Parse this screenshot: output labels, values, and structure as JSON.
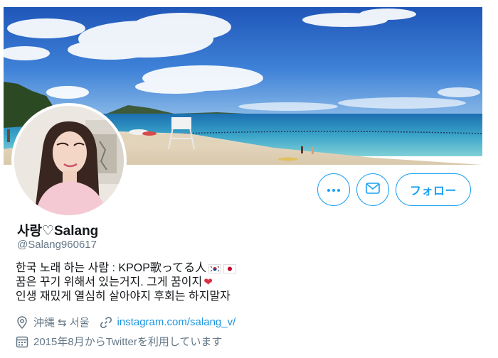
{
  "profile": {
    "display_name": "사랑♡Salang",
    "handle": "@Salang960617",
    "bio": {
      "line1": "한국 노래 하는 사람 : KPOP歌ってる人",
      "line2": "꿈은 꾸기 위해서 있는거지. 그게 꿈이지",
      "line3": "인생 재밌게 열심히 살아야지 후회는 하지말자"
    },
    "location": "沖縄 ⇆ 서울",
    "website": "instagram.com/salang_v/",
    "joined": "2015年8月からTwitterを利用しています"
  },
  "actions": {
    "follow_label": "フォロー"
  },
  "icons": {
    "more": "more-icon",
    "message": "envelope-icon",
    "location": "location-pin-icon",
    "link": "link-icon",
    "calendar": "calendar-icon"
  },
  "colors": {
    "accent": "#1da1f2",
    "link": "#1b95e0",
    "secondary_text": "#657786",
    "heart": "#dd2e44"
  }
}
